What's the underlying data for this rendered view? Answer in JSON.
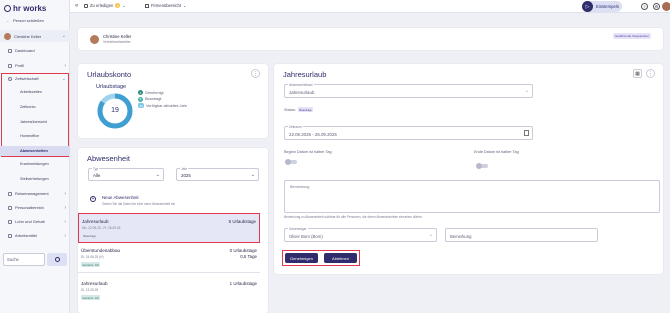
{
  "brand": "hr works",
  "sidebar": {
    "back_label": "Person schließen",
    "user_name": "Christine Keller",
    "items": [
      {
        "label": "Dashboard"
      },
      {
        "label": "Profil"
      },
      {
        "label": "Zeitwirtschaft"
      }
    ],
    "sub_items": [
      {
        "label": "Arbeitszeiten"
      },
      {
        "label": "Zeitkonto"
      },
      {
        "label": "Jahresübersicht"
      },
      {
        "label": "Homeoffice"
      },
      {
        "label": "Abwesenheiten"
      },
      {
        "label": "Krankmeldungen"
      },
      {
        "label": "Stellvertretungen"
      }
    ],
    "more_items": [
      {
        "label": "Reisemanagement"
      },
      {
        "label": "Personalbereich"
      },
      {
        "label": "Lohn und Gehalt"
      },
      {
        "label": "Arbeitsmittel"
      }
    ],
    "search_placeholder": "Suche"
  },
  "topbar": {
    "todo_label": "Zu erledigen",
    "todo_count": "1",
    "company_label": "Firmenübersicht",
    "clock_label": "Einstempeln"
  },
  "person": {
    "name": "Christine Keller",
    "role": "Vertriebsmitarbeiter",
    "status_badge": "Geöffnet als Vorgesetzter"
  },
  "urlaubskonto": {
    "title": "Urlaubskonto",
    "donut_label": "Urlaubstage",
    "donut_value": "19",
    "legend": [
      {
        "count": "1",
        "label": "Genehmigt",
        "color": "#2f8f7f"
      },
      {
        "count": "5",
        "label": "Beantragt",
        "color": "#46b3a7"
      },
      {
        "count": "19",
        "label": "Verfügbar aktuelles Jahr",
        "color": "#7cc8e6"
      }
    ]
  },
  "abwesenheit": {
    "title": "Abwesenheit",
    "typ_label": "Typ",
    "typ_value": "Alle",
    "jahr_label": "Jahr",
    "jahr_value": "2025",
    "new_title": "Neue Abwesenheit",
    "new_sub": "Geben Sie die Daten für eine neue Abwesenheit ein",
    "entries": [
      {
        "title": "Jahresurlaub",
        "dates": "Mo. 22.09.25 - Fr. 26.09.25",
        "days": "5 Urlaubstage",
        "extra": "",
        "badge": "Beantragt"
      },
      {
        "title": "Überstundenabbau",
        "dates": "Di. 24.06.25 (H)",
        "days": "0 Urlaubstage",
        "extra": "0,5 Tage",
        "badge": "Genehm. GK"
      },
      {
        "title": "Jahresurlaub",
        "dates": "Di. 13.05.25",
        "days": "1 Urlaubstage",
        "extra": "",
        "badge": "Genehm. GK"
      }
    ]
  },
  "jahresurlaub": {
    "title": "Jahresurlaub",
    "type_field_label": "Abwesenheitsart",
    "type_value": "Jahresurlaub",
    "status_label": "Status:",
    "status_value": "Beantragt",
    "period_label": "Zeitraum",
    "period_value": "22.09.2025 - 26.09.2025",
    "begin_half_label": "Beginn Datum ist halber Tag",
    "end_half_label": "Ende Datum ist halber Tag",
    "remark_placeholder": "Bemerkung",
    "remark_hint": "Bemerkung zu Abwesenheit sichtbar für alle Personen, die deren Abwesenheiten einsehen dürfen.",
    "approver_label": "Genehmiger",
    "approver_value": "Oliver Born (Born)",
    "approver_remark_placeholder": "Bemerkung",
    "approve_label": "Genehmigen",
    "reject_label": "Ablehnen"
  }
}
